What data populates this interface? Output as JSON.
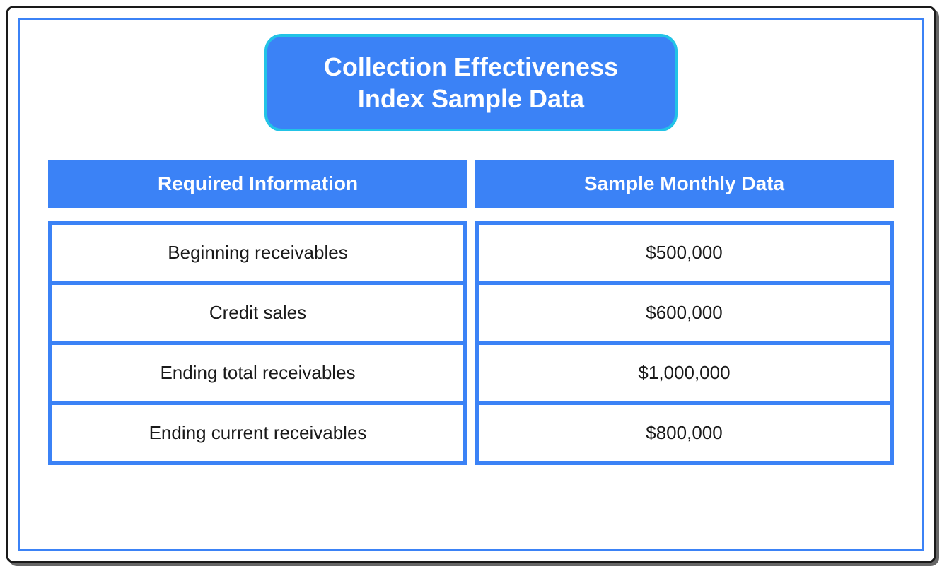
{
  "title_line1": "Collection Effectiveness",
  "title_line2": "Index Sample Data",
  "headers": {
    "col1": "Required Information",
    "col2": "Sample Monthly Data"
  },
  "rows": [
    {
      "label": "Beginning receivables",
      "value": "$500,000"
    },
    {
      "label": "Credit sales",
      "value": "$600,000"
    },
    {
      "label": "Ending total receivables",
      "value": "$1,000,000"
    },
    {
      "label": "Ending current receivables",
      "value": "$800,000"
    }
  ],
  "chart_data": {
    "type": "table",
    "title": "Collection Effectiveness Index Sample Data",
    "columns": [
      "Required Information",
      "Sample Monthly Data"
    ],
    "data": [
      [
        "Beginning receivables",
        500000
      ],
      [
        "Credit sales",
        600000
      ],
      [
        "Ending total receivables",
        1000000
      ],
      [
        "Ending current receivables",
        800000
      ]
    ],
    "currency": "USD"
  }
}
